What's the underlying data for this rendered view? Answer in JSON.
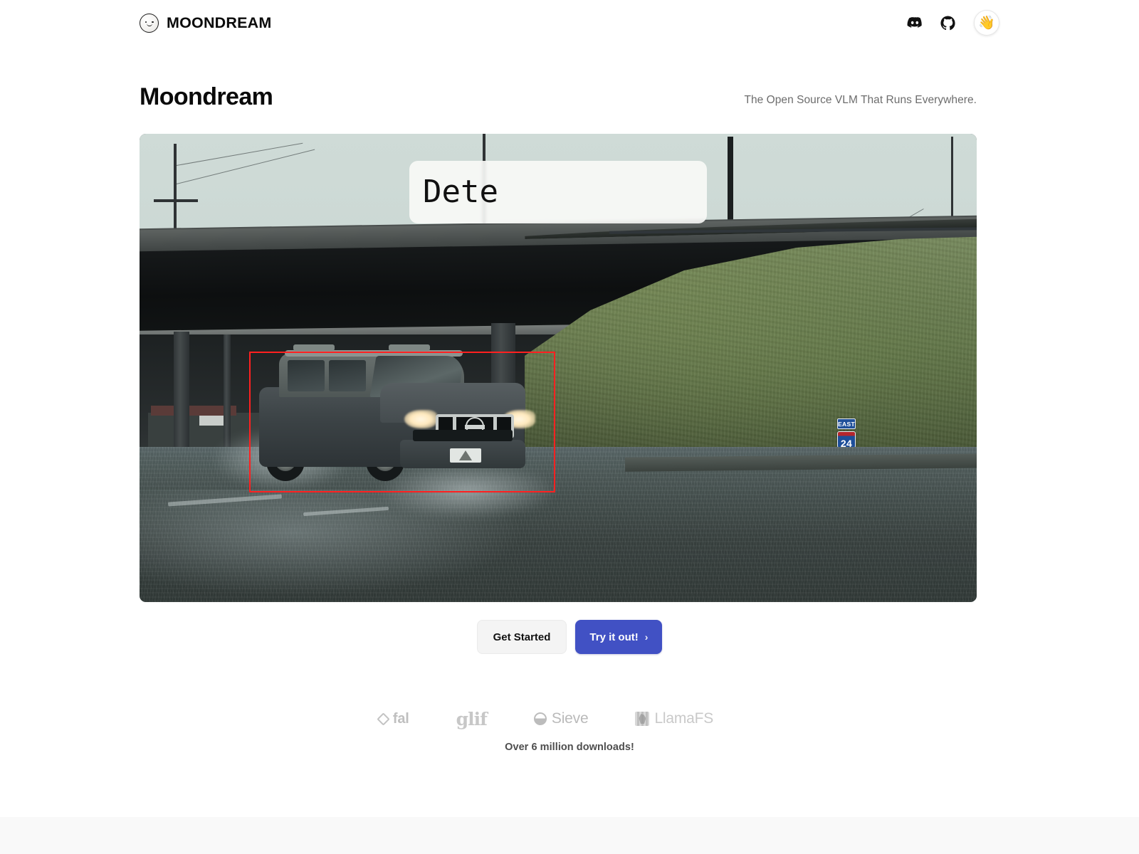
{
  "header": {
    "brand_name": "MOONDREAM",
    "brand_logo_icon": "moon-face-icon",
    "actions": [
      {
        "name": "discord-link",
        "icon": "discord-icon",
        "label": "Discord"
      },
      {
        "name": "github-link",
        "icon": "github-icon",
        "label": "GitHub"
      },
      {
        "name": "wave-button",
        "icon": "waving-hand-icon",
        "label": "👋"
      }
    ]
  },
  "hero": {
    "title": "Moondream",
    "tagline": "The Open Source VLM That Runs Everywhere.",
    "caption_typing_text": "Dete",
    "media": {
      "alt": "Dark SUV driving on a wet road under a highway overpass in heavy rain",
      "detection_box_color": "#ff2020",
      "road_sign": {
        "direction": "EAST",
        "route": "24",
        "arrow": "⬑"
      }
    }
  },
  "cta": {
    "secondary_label": "Get Started",
    "primary_label": "Try it out!",
    "primary_chevron": "›"
  },
  "logos": [
    {
      "name": "logo-fal",
      "label": "fal"
    },
    {
      "name": "logo-glif",
      "label": "glif"
    },
    {
      "name": "logo-sieve",
      "label": "Sieve"
    },
    {
      "name": "logo-llamafs",
      "label": "LlamaFS"
    },
    {
      "name": "logo-next-fading",
      "label": ""
    }
  ],
  "downloads_text": "Over 6 million downloads!",
  "colors": {
    "primary_button": "#4151c4",
    "secondary_button": "#f4f4f4",
    "detection_box": "#ff2020",
    "text_primary": "#0a0a0a",
    "text_muted": "#6d6d6d",
    "logo_gray": "#bcbcbc",
    "next_section_bg": "#f9f9f9"
  }
}
